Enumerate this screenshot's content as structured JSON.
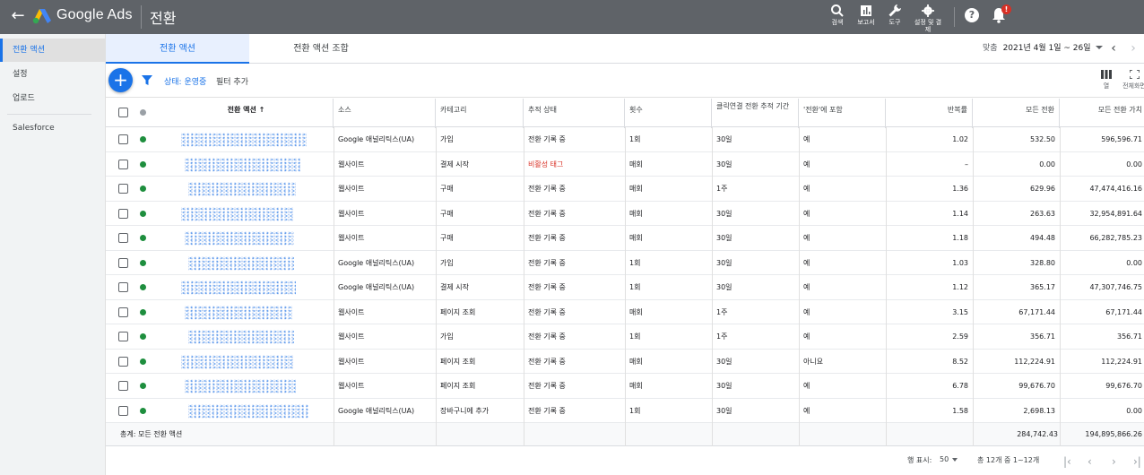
{
  "header": {
    "brand": "Google Ads",
    "section": "전환",
    "tools": [
      {
        "icon": "search-icon",
        "label": "검색"
      },
      {
        "icon": "reports-icon",
        "label": "보고서"
      },
      {
        "icon": "wrench-icon",
        "label": "도구"
      },
      {
        "icon": "gear-icon",
        "label": "설정 및 결제"
      }
    ],
    "notification_count": "!"
  },
  "sidebar": {
    "items": [
      {
        "label": "전환 액션"
      },
      {
        "label": "설정"
      },
      {
        "label": "업로드"
      },
      {
        "label": "Salesforce"
      }
    ]
  },
  "tabs": [
    {
      "label": "전환 액션"
    },
    {
      "label": "전환 액션 조합"
    }
  ],
  "date": {
    "label": "맞춤",
    "range": "2021년 4월 1일 ~ 26일"
  },
  "toolbar": {
    "add": "+",
    "filter_chip": "상태: 운영중",
    "add_filter": "필터 추가",
    "columns_label": "열",
    "fullscreen_label": "전체화면"
  },
  "table": {
    "columns": [
      "전환 액션",
      "소스",
      "카테고리",
      "추적 상태",
      "횟수",
      "클릭연결 전환 추적 기간",
      "'전환'에 포함",
      "반복률",
      "모든 전환",
      "모든 전환 가치"
    ],
    "sort_indicator": "↑",
    "rows": [
      {
        "source": "Google 애널리틱스(UA)",
        "category": "가입",
        "status": "전환 기록 중",
        "count": "1회",
        "window": "30일",
        "include": "예",
        "rate": "1.02",
        "all": "532.50",
        "value": "596,596.71",
        "status_color": "#1e8e3e",
        "status_inactive": false
      },
      {
        "source": "웹사이트",
        "category": "결제 시작",
        "status": "비활성 태그",
        "count": "매회",
        "window": "30일",
        "include": "예",
        "rate": "–",
        "all": "0.00",
        "value": "0.00",
        "status_color": "#1e8e3e",
        "status_inactive": true
      },
      {
        "source": "웹사이트",
        "category": "구매",
        "status": "전환 기록 중",
        "count": "매회",
        "window": "1주",
        "include": "예",
        "rate": "1.36",
        "all": "629.96",
        "value": "47,474,416.16",
        "status_color": "#1e8e3e",
        "status_inactive": false
      },
      {
        "source": "웹사이트",
        "category": "구매",
        "status": "전환 기록 중",
        "count": "매회",
        "window": "30일",
        "include": "예",
        "rate": "1.14",
        "all": "263.63",
        "value": "32,954,891.64",
        "status_color": "#1e8e3e",
        "status_inactive": false
      },
      {
        "source": "웹사이트",
        "category": "구매",
        "status": "전환 기록 중",
        "count": "매회",
        "window": "30일",
        "include": "예",
        "rate": "1.18",
        "all": "494.48",
        "value": "66,282,785.23",
        "status_color": "#1e8e3e",
        "status_inactive": false
      },
      {
        "source": "Google 애널리틱스(UA)",
        "category": "가입",
        "status": "전환 기록 중",
        "count": "1회",
        "window": "30일",
        "include": "예",
        "rate": "1.03",
        "all": "328.80",
        "value": "0.00",
        "status_color": "#1e8e3e",
        "status_inactive": false
      },
      {
        "source": "Google 애널리틱스(UA)",
        "category": "결제 시작",
        "status": "전환 기록 중",
        "count": "1회",
        "window": "30일",
        "include": "예",
        "rate": "1.12",
        "all": "365.17",
        "value": "47,307,746.75",
        "status_color": "#1e8e3e",
        "status_inactive": false
      },
      {
        "source": "웹사이트",
        "category": "페이지 조회",
        "status": "전환 기록 중",
        "count": "매회",
        "window": "1주",
        "include": "예",
        "rate": "3.15",
        "all": "67,171.44",
        "value": "67,171.44",
        "status_color": "#1e8e3e",
        "status_inactive": false
      },
      {
        "source": "웹사이트",
        "category": "가입",
        "status": "전환 기록 중",
        "count": "1회",
        "window": "1주",
        "include": "예",
        "rate": "2.59",
        "all": "356.71",
        "value": "356.71",
        "status_color": "#1e8e3e",
        "status_inactive": false
      },
      {
        "source": "웹사이트",
        "category": "페이지 조회",
        "status": "전환 기록 중",
        "count": "매회",
        "window": "30일",
        "include": "아니요",
        "rate": "8.52",
        "all": "112,224.91",
        "value": "112,224.91",
        "status_color": "#1e8e3e",
        "status_inactive": false
      },
      {
        "source": "웹사이트",
        "category": "페이지 조회",
        "status": "전환 기록 중",
        "count": "매회",
        "window": "30일",
        "include": "예",
        "rate": "6.78",
        "all": "99,676.70",
        "value": "99,676.70",
        "status_color": "#1e8e3e",
        "status_inactive": false
      },
      {
        "source": "Google 애널리틱스(UA)",
        "category": "장바구니에 추가",
        "status": "전환 기록 중",
        "count": "1회",
        "window": "30일",
        "include": "예",
        "rate": "1.58",
        "all": "2,698.13",
        "value": "0.00",
        "status_color": "#1e8e3e",
        "status_inactive": false
      }
    ],
    "total": {
      "label": "총계: 모든 전환 액션",
      "all": "284,742.43",
      "value": "194,895,866.26"
    }
  },
  "footer": {
    "rows_label": "행 표시:",
    "rows_value": "50",
    "range": "총 12개 중 1~12개"
  },
  "colors": {
    "accent": "#1a73e8",
    "topbar": "#5f6368",
    "active_green": "#1e8e3e",
    "inactive_red": "#d93025"
  }
}
